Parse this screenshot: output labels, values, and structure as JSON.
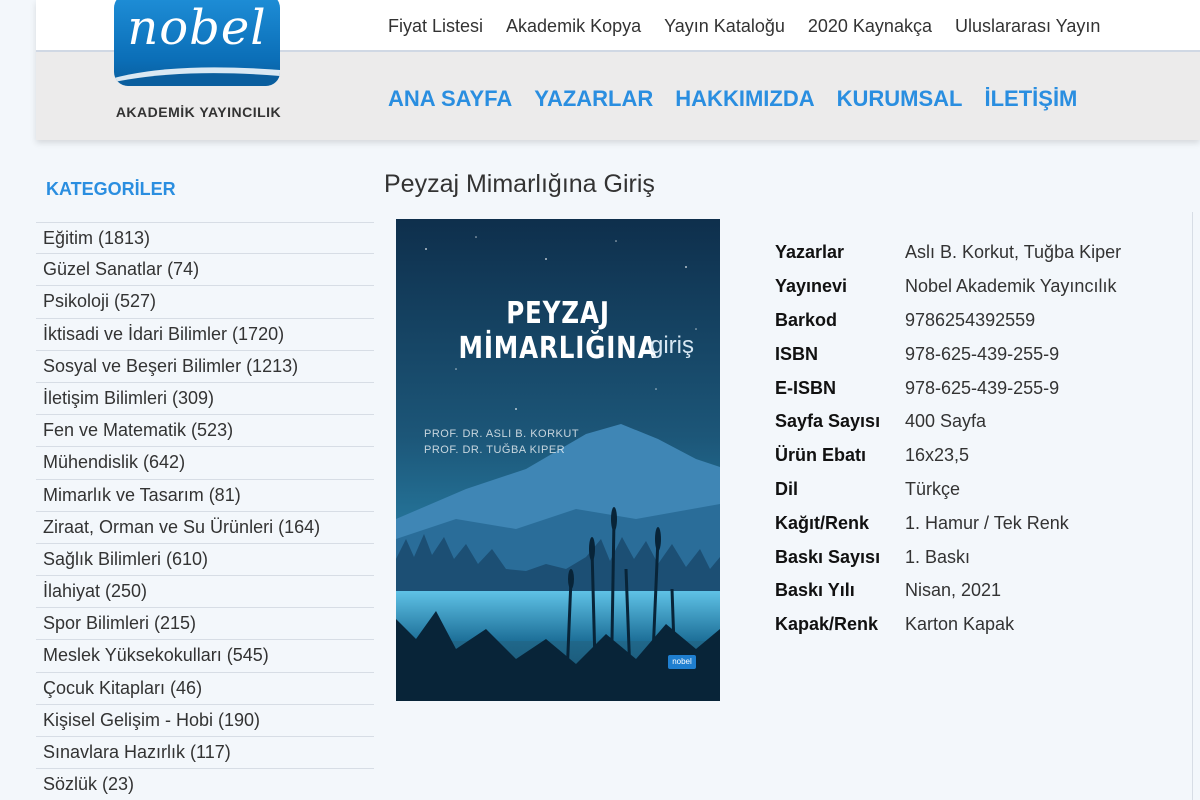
{
  "logo": {
    "text": "nobel",
    "subtitle": "AKADEMİK YAYINCILIK"
  },
  "top_links": [
    "Fiyat Listesi",
    "Akademik Kopya",
    "Yayın Kataloğu",
    "2020 Kaynakça",
    "Uluslararası Yayın"
  ],
  "main_nav": [
    "ANA SAYFA",
    "YAZARLAR",
    "HAKKIMIZDA",
    "KURUMSAL",
    "İLETİŞİM"
  ],
  "sidebar": {
    "title": "KATEGORİLER",
    "categories": [
      "Eğitim (1813)",
      "Güzel Sanatlar (74)",
      "Psikoloji (527)",
      "İktisadi ve İdari Bilimler (1720)",
      "Sosyal ve Beşeri Bilimler (1213)",
      "İletişim Bilimleri (309)",
      "Fen ve Matematik (523)",
      "Mühendislik (642)",
      "Mimarlık ve Tasarım (81)",
      "Ziraat, Orman ve Su Ürünleri (164)",
      "Sağlık Bilimleri (610)",
      "İlahiyat (250)",
      "Spor Bilimleri (215)",
      "Meslek Yüksekokulları (545)",
      "Çocuk Kitapları (46)",
      "Kişisel Gelişim - Hobi (190)",
      "Sınavlara Hazırlık (117)",
      "Sözlük (23)"
    ]
  },
  "product": {
    "title": "Peyzaj Mimarlığına Giriş",
    "cover": {
      "title": "PEYZAJ MİMARLIĞINA",
      "subtitle": "giriş",
      "authors": [
        "PROF. DR. ASLI B. KORKUT",
        "PROF. DR. TUĞBA KIPER"
      ],
      "publisher_mark": "nobel"
    },
    "details": [
      {
        "label": "Yazarlar",
        "value": "Aslı B. Korkut, Tuğba Kiper"
      },
      {
        "label": "Yayınevi",
        "value": "Nobel Akademik Yayıncılık"
      },
      {
        "label": "Barkod",
        "value": "9786254392559"
      },
      {
        "label": "ISBN",
        "value": "978-625-439-255-9"
      },
      {
        "label": "E-ISBN",
        "value": "978-625-439-255-9"
      },
      {
        "label": "Sayfa Sayısı",
        "value": "400 Sayfa"
      },
      {
        "label": "Ürün Ebatı",
        "value": "16x23,5"
      },
      {
        "label": "Dil",
        "value": "Türkçe"
      },
      {
        "label": "Kağıt/Renk",
        "value": "1. Hamur / Tek Renk"
      },
      {
        "label": "Baskı Sayısı",
        "value": "1. Baskı"
      },
      {
        "label": "Baskı Yılı",
        "value": "Nisan, 2021"
      },
      {
        "label": "Kapak/Renk",
        "value": "Karton Kapak"
      }
    ]
  },
  "colors": {
    "accent": "#2a8ee0",
    "logo_blue": "#0b6fb8",
    "background": "#f3f7fb",
    "header_bg": "#ecebeb"
  }
}
